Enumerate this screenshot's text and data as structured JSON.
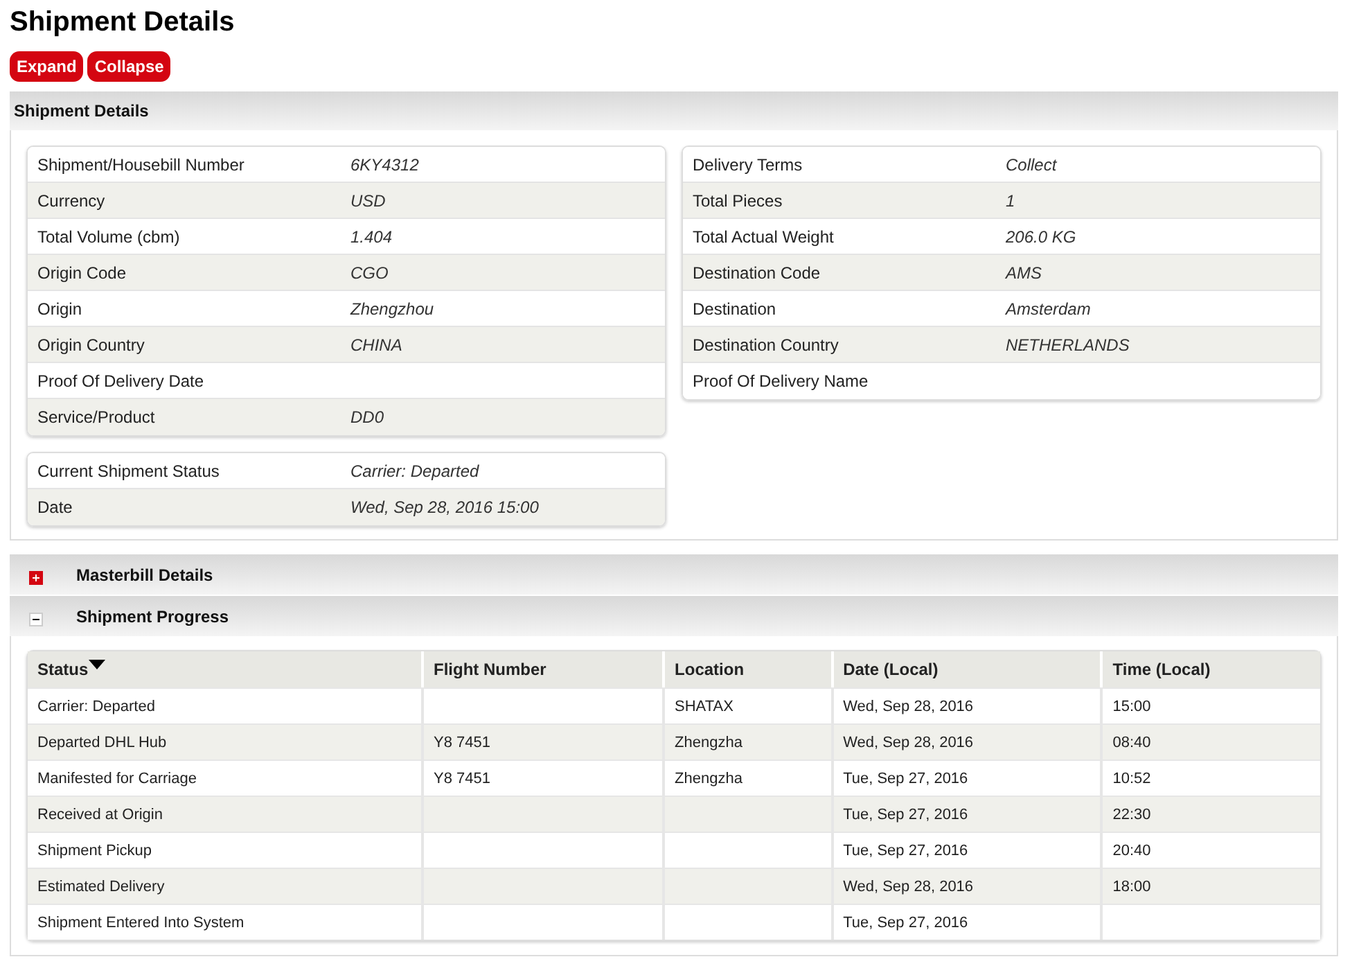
{
  "title": "Shipment Details",
  "buttons": [
    "Expand",
    "Collapse"
  ],
  "details": {
    "title": "Shipment Details",
    "left": [
      {
        "label": "Shipment/Housebill Number",
        "value": "6KY4312"
      },
      {
        "label": "Currency",
        "value": "USD"
      },
      {
        "label": "Total Volume (cbm)",
        "value": "1.404"
      },
      {
        "label": "Origin Code",
        "value": "CGO"
      },
      {
        "label": "Origin",
        "value": "Zhengzhou"
      },
      {
        "label": "Origin Country",
        "value": "CHINA"
      },
      {
        "label": "Proof Of Delivery Date"
      },
      {
        "label": "Service/Product",
        "value": "DD0"
      }
    ],
    "right": [
      {
        "label": "Delivery Terms",
        "value": "Collect"
      },
      {
        "label": "Total Pieces",
        "value": "1"
      },
      {
        "label": "Total Actual Weight",
        "value": "206.0 KG"
      },
      {
        "label": "Destination Code",
        "value": "AMS"
      },
      {
        "label": "Destination",
        "value": "Amsterdam"
      },
      {
        "label": "Destination Country",
        "value": "NETHERLANDS"
      },
      {
        "label": "Proof Of Delivery Name"
      }
    ],
    "status": [
      {
        "label": "Current Shipment Status",
        "value": "Carrier: Departed"
      },
      {
        "label": "Date",
        "value": "Wed, Sep 28, 2016 15:00"
      }
    ]
  },
  "sections": [
    {
      "title": "Masterbill Details",
      "expanded": false
    },
    {
      "title": "Shipment Progress",
      "expanded": true
    }
  ],
  "progress": {
    "columns": [
      {
        "label": "Status",
        "sorted": true
      },
      {
        "label": "Flight Number",
        "sorted": false
      },
      {
        "label": "Location",
        "sorted": false
      },
      {
        "label": "Date (Local)",
        "sorted": false
      },
      {
        "label": "Time (Local)",
        "sorted": false
      }
    ],
    "rows": [
      [
        "Carrier: Departed",
        null,
        "SHATAX",
        "Wed, Sep 28, 2016",
        "15:00"
      ],
      [
        "Departed DHL Hub",
        "Y8 7451",
        "Zhengzha",
        "Wed, Sep 28, 2016",
        "08:40"
      ],
      [
        "Manifested for Carriage",
        "Y8 7451",
        "Zhengzha",
        "Tue, Sep 27, 2016",
        "10:52"
      ],
      [
        "Received at Origin",
        null,
        null,
        "Tue, Sep 27, 2016",
        "22:30"
      ],
      [
        "Shipment Pickup",
        null,
        null,
        "Tue, Sep 27, 2016",
        "20:40"
      ],
      [
        "Estimated Delivery",
        null,
        null,
        "Wed, Sep 28, 2016",
        "18:00"
      ],
      [
        "Shipment Entered Into System",
        null,
        null,
        "Tue, Sep 27, 2016",
        null
      ]
    ]
  }
}
